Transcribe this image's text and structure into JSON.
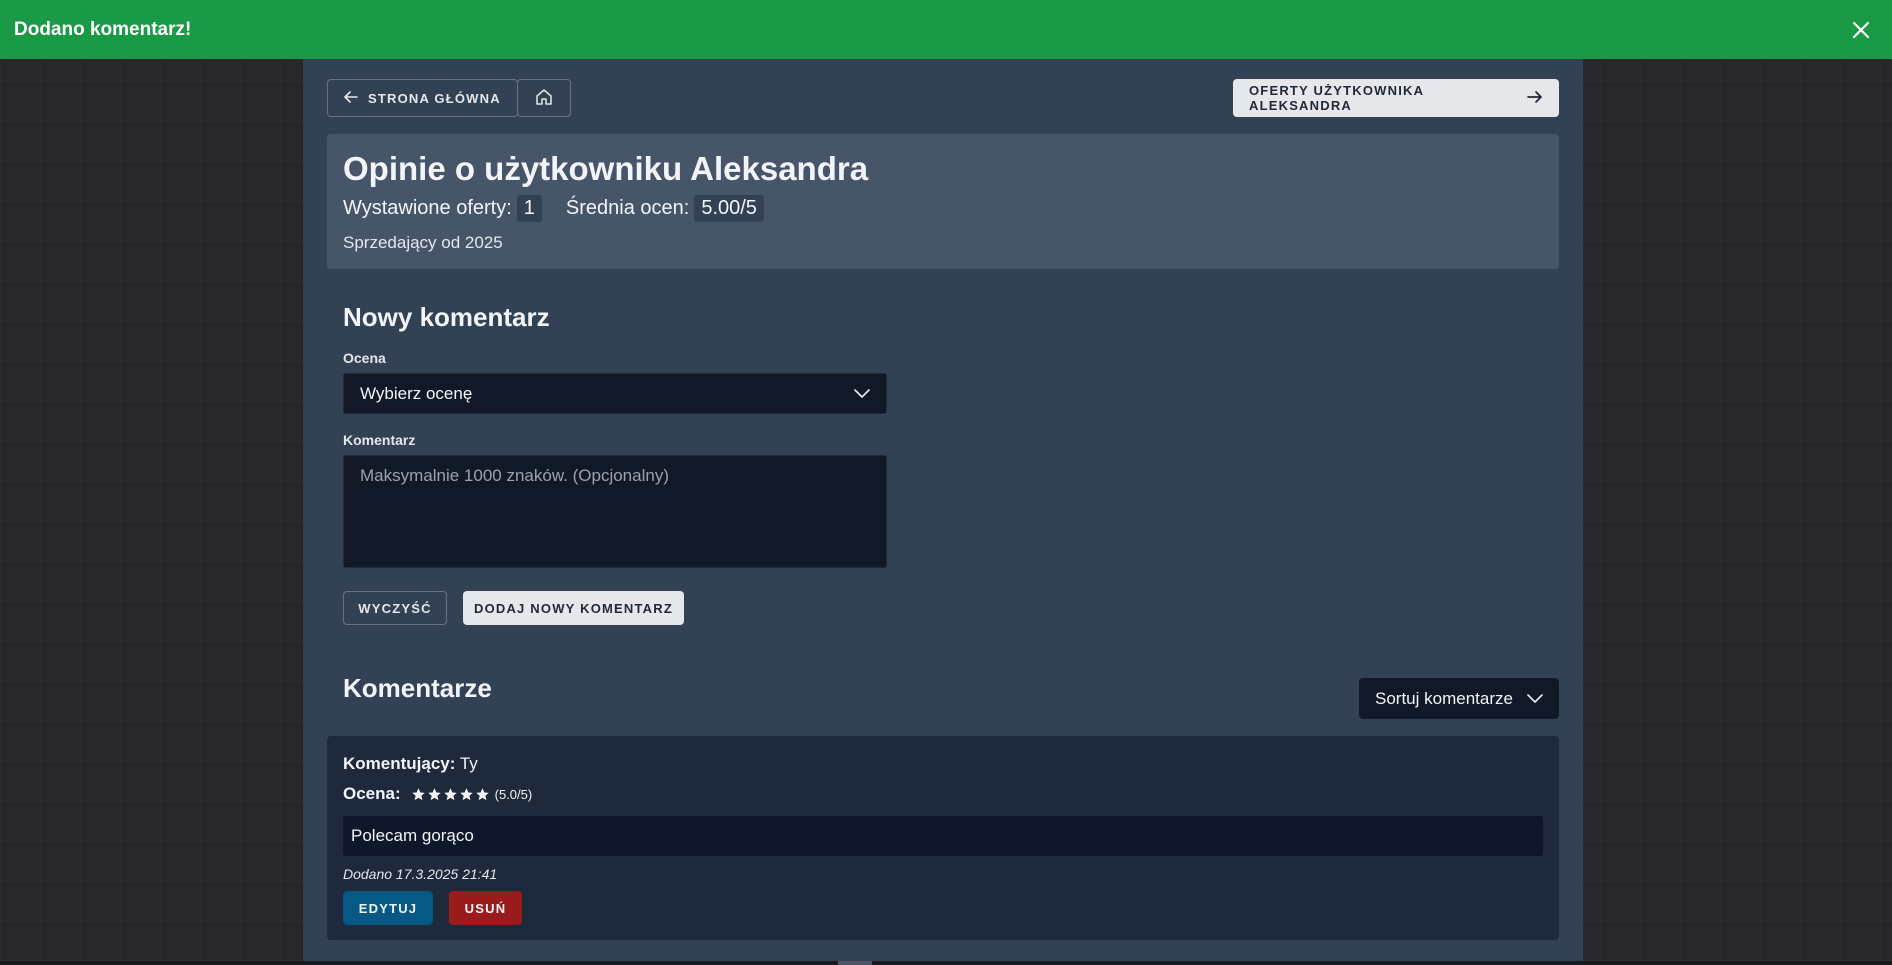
{
  "toast": {
    "message": "Dodano komentarz!",
    "close_icon": "close-icon",
    "color": "#1a9947"
  },
  "nav": {
    "back_label": "STRONA GŁÓWNA",
    "back_icon": "arrow-left-icon",
    "home_icon": "home-icon",
    "offers_label": "OFERTY UŻYTKOWNIKA ALEKSANDRA",
    "offers_icon": "arrow-right-icon"
  },
  "profile": {
    "title": "Opinie o użytkowniku Aleksandra",
    "offers_label": "Wystawione oferty:",
    "offers_count": "1",
    "avg_label": "Średnia ocen:",
    "avg_value": "5.00/5",
    "since": "Sprzedający od 2025"
  },
  "new_comment": {
    "heading": "Nowy komentarz",
    "rating_label": "Ocena",
    "rating_selected": "Wybierz ocenę",
    "comment_label": "Komentarz",
    "comment_placeholder": "Maksymalnie 1000 znaków. (Opcjonalny)",
    "clear_label": "WYCZYŚĆ",
    "submit_label": "DODAJ NOWY KOMENTARZ"
  },
  "comments": {
    "heading": "Komentarze",
    "sort_label": "Sortuj komentarze",
    "items": [
      {
        "author_label": "Komentujący:",
        "author": "Ty",
        "rating_label": "Ocena:",
        "stars": 5,
        "rating_text": "(5.0/5)",
        "text": "Polecam gorąco",
        "added": "Dodano 17.3.2025 21:41",
        "edit_label": "EDYTUJ",
        "delete_label": "USUŃ"
      }
    ]
  },
  "colors": {
    "edit": "#075985",
    "delete": "#991b1b"
  }
}
